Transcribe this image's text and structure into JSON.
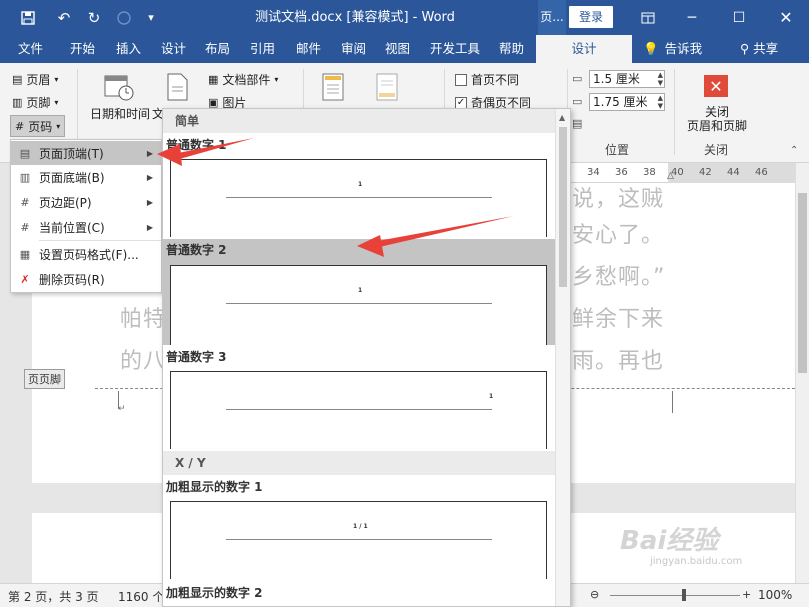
{
  "titlebar": {
    "document_title": "测试文档.docx [兼容模式]  -  Word",
    "context_tab_short": "页...",
    "login_label": "登录",
    "quick_access_icons": [
      "save-icon",
      "undo-icon",
      "redo-icon",
      "circle-icon",
      "customize-icon"
    ]
  },
  "tabs": [
    "文件",
    "开始",
    "插入",
    "设计",
    "布局",
    "引用",
    "邮件",
    "审阅",
    "视图",
    "开发工具",
    "帮助",
    "设计",
    "告诉我",
    "共享"
  ],
  "ribbon": {
    "header_label": "页眉",
    "footer_label": "页脚",
    "pagenum_label": "页码",
    "datetime_label": "日期和时间",
    "doc_info_label": "文",
    "doc_parts_label": "文档部件",
    "picture_label": "图片",
    "first_page_diff": "首页不同",
    "odd_even_diff": "奇偶页不同",
    "header_top_value": "1.5 厘米",
    "footer_bottom_value": "1.75 厘米",
    "position_group": "位置",
    "close_button_line1": "关闭",
    "close_button_line2": "页眉和页脚",
    "close_group": "关闭"
  },
  "ruler_ticks": [
    "34",
    "36",
    "38",
    "40",
    "42",
    "44",
    "46"
  ],
  "document": {
    "line1": "说，这贼",
    "line2": "安心了。",
    "line3": "乡愁啊。”",
    "line4a": "帕特",
    "line4b": "鲜余下来",
    "line5a": "的八",
    "line5b": "雨。再也",
    "footer_tag": "页页脚"
  },
  "menu": {
    "items": [
      {
        "label": "页面顶端(T)",
        "icon": "page-top-icon",
        "submenu": true
      },
      {
        "label": "页面底端(B)",
        "icon": "page-bottom-icon",
        "submenu": true
      },
      {
        "label": "页边距(P)",
        "icon": "page-margin-icon",
        "submenu": true
      },
      {
        "label": "当前位置(C)",
        "icon": "current-position-icon",
        "submenu": true
      },
      {
        "label": "设置页码格式(F)...",
        "icon": "format-pagenum-icon",
        "submenu": false
      },
      {
        "label": "删除页码(R)",
        "icon": "delete-pagenum-icon",
        "submenu": false
      }
    ]
  },
  "gallery": {
    "section_simple": "简单",
    "item1": "普通数字 1",
    "item2": "普通数字 2",
    "item3": "普通数字 3",
    "section_xy": "X / Y",
    "item4": "加粗显示的数字 1",
    "item5": "加粗显示的数字 2",
    "pn_plain": "1",
    "pn_xy": "1 / 1"
  },
  "statusbar": {
    "page_info": "第 2 页，共 3 页",
    "word_count": "1160 个",
    "zoom": "100%"
  },
  "watermark": {
    "text": "Bai经验",
    "sub": "jingyan.baidu.com"
  },
  "colors": {
    "title_bar": "#2b579a",
    "arrow": "#e8413a",
    "close_button": "#e04a3a"
  }
}
